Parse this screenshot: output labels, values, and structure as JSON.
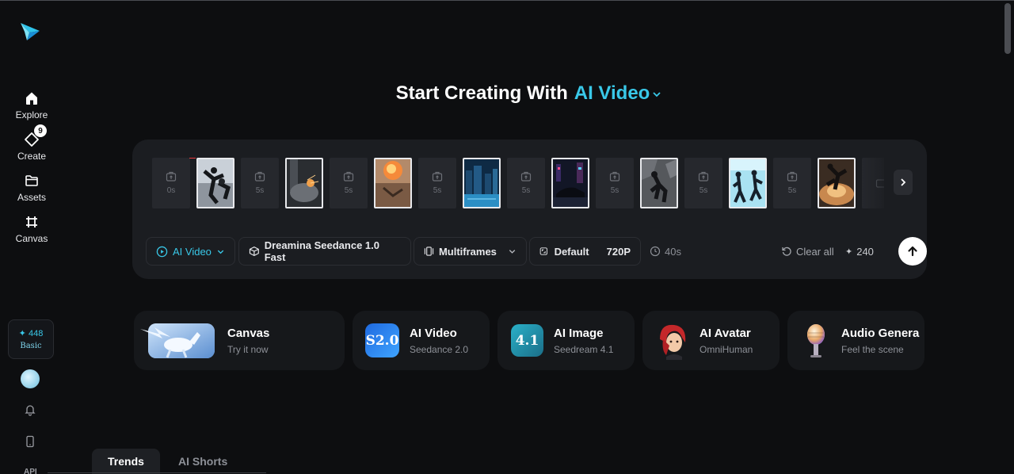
{
  "sidebar": {
    "logo": "dreamina-logo",
    "items": [
      {
        "label": "Explore",
        "icon": "home-icon"
      },
      {
        "label": "Create",
        "icon": "create-icon",
        "badge": "9"
      },
      {
        "label": "Assets",
        "icon": "folder-icon"
      },
      {
        "label": "Canvas",
        "icon": "canvas-icon"
      }
    ],
    "credits": {
      "value": "448",
      "plan": "Basic"
    },
    "api_label": "API"
  },
  "header": {
    "title_prefix": "Start Creating With",
    "title_accent": "AI Video"
  },
  "frames": {
    "slots": [
      "0s",
      "5s",
      "5s",
      "5s",
      "5s",
      "5s",
      "5s",
      "5s"
    ],
    "thumbnails": [
      "thumbnail-fight-scene",
      "thumbnail-sparks-scene",
      "thumbnail-explosion-scene",
      "thumbnail-city-night-scene",
      "thumbnail-car-neon-scene",
      "thumbnail-crumbling-wall-scene",
      "thumbnail-running-scene",
      "thumbnail-dust-explosion-scene"
    ]
  },
  "toolbar": {
    "mode": "AI Video",
    "model": "Dreamina Seedance 1.0 Fast",
    "frame_mode": "Multiframes",
    "ratio": "Default",
    "resolution": "720P",
    "duration": "40s",
    "clear": "Clear all",
    "cost": "240"
  },
  "cards": [
    {
      "title": "Canvas",
      "subtitle": "Try it now",
      "image": "pegasus-image"
    },
    {
      "title": "AI Video",
      "subtitle": "Seedance 2.0",
      "image": "s2-logo-image",
      "logo_text": "S2.0"
    },
    {
      "title": "AI Image",
      "subtitle": "Seedream 4.1",
      "image": "seedream-logo-image",
      "logo_text": "4.1"
    },
    {
      "title": "AI Avatar",
      "subtitle": "OmniHuman",
      "image": "avatar-character-image"
    },
    {
      "title": "Audio Genera",
      "subtitle": "Feel the scene",
      "image": "microphone-image"
    }
  ],
  "tabs": [
    "Trends",
    "AI Shorts"
  ],
  "colors": {
    "accent": "#39c8e8",
    "background": "#0d0e10",
    "panel": "#1b1d21"
  }
}
